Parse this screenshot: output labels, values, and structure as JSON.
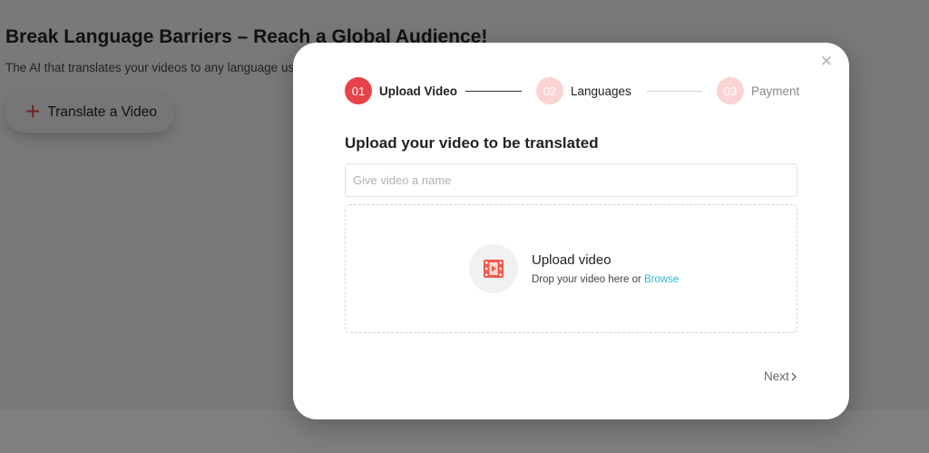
{
  "background": {
    "title": "Break Language Barriers – Reach a Global Audience!",
    "subtitle": "The AI that translates your videos to any language usi",
    "cta_label": "Translate a Video"
  },
  "modal": {
    "close_icon": "close-icon",
    "steps": [
      {
        "number": "01",
        "label": "Upload Video"
      },
      {
        "number": "02",
        "label": "Languages"
      },
      {
        "number": "03",
        "label": "Payment"
      }
    ],
    "heading": "Upload your video to be translated",
    "name_input": {
      "placeholder": "Give video a name",
      "value": ""
    },
    "dropzone": {
      "icon": "video-file-icon",
      "title": "Upload video",
      "subtitle": "Drop your video here or",
      "browse_label": "Browse"
    },
    "next_label": "Next"
  },
  "colors": {
    "accent": "#e8424a",
    "accent_light": "#fbd3d3",
    "link": "#2bb5d9"
  }
}
